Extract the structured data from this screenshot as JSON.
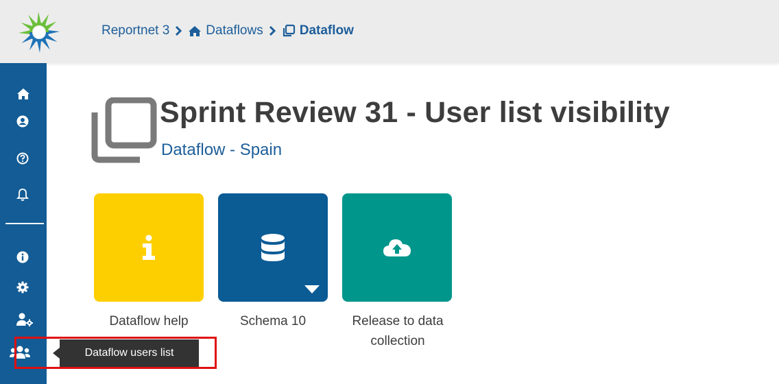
{
  "breadcrumb": {
    "items": [
      "Reportnet 3",
      "Dataflows",
      "Dataflow"
    ],
    "icons": [
      "home-icon",
      "clone-icon"
    ]
  },
  "sidebar": {
    "top_items": [
      "home-icon",
      "user-circle-icon",
      "question-circle-icon",
      "bell-icon"
    ],
    "bottom_items": [
      "info-circle-icon",
      "cog-icon",
      "user-cog-icon",
      "users-icon"
    ],
    "background": "#135c95"
  },
  "page": {
    "title": "Sprint Review 31 - User list visibility",
    "subtitle": "Dataflow - Spain"
  },
  "cards": [
    {
      "label": "Dataflow help",
      "icon": "info-icon",
      "color": "#fdcf00"
    },
    {
      "label": "Schema 10",
      "icon": "database-icon",
      "color": "#0b5b95"
    },
    {
      "label": "Release to data collection",
      "icon": "cloud-upload-icon",
      "color": "#01968c"
    }
  ],
  "tooltip": {
    "text": "Dataflow users list"
  },
  "colors": {
    "accent": "#1d5e9a",
    "highlight": "#e01010"
  }
}
